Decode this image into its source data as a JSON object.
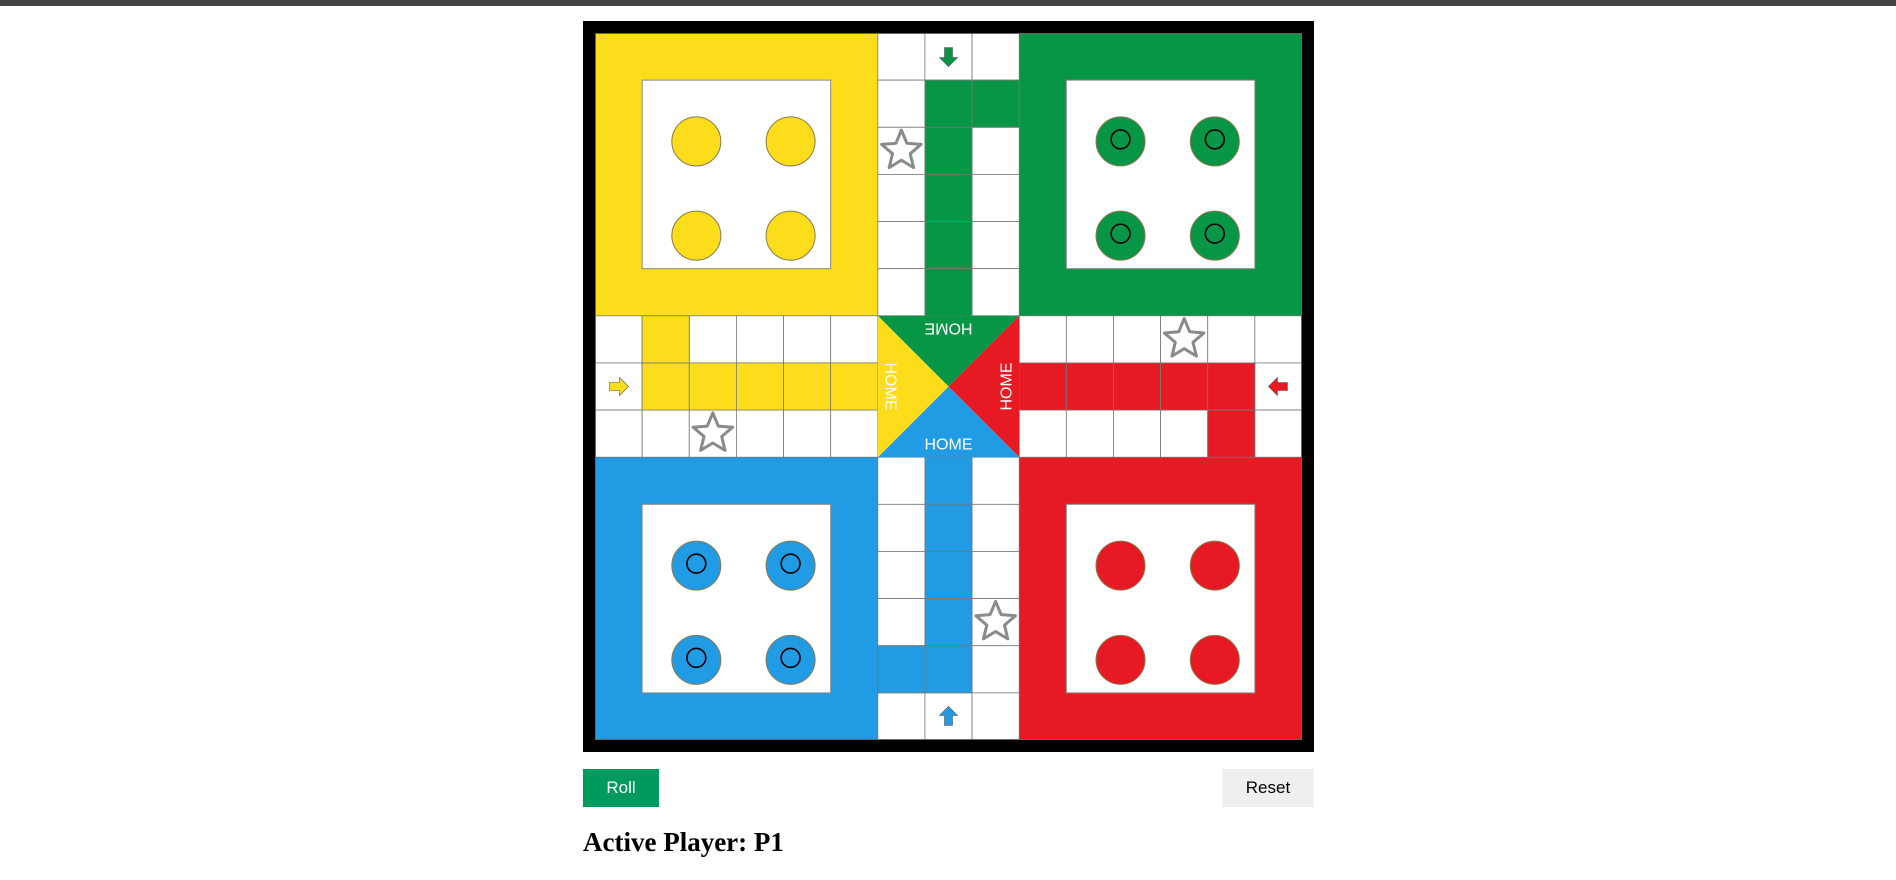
{
  "colors": {
    "yellow": "#FCDD1B",
    "green": "#079645",
    "red": "#E71A23",
    "blue": "#229BE5",
    "roll_button": "#009A5C",
    "reset_button": "#EFEFEF",
    "top_bar": "#444444"
  },
  "board": {
    "center_labels": [
      "HOME",
      "HOME",
      "HOME",
      "HOME"
    ],
    "icons": [
      "start-arrow-icon",
      "safe-star-icon",
      "token-icon"
    ],
    "tokens": {
      "yellow": {
        "count": 4,
        "marked": false
      },
      "green": {
        "count": 4,
        "marked": true
      },
      "red": {
        "count": 4,
        "marked": false
      },
      "blue": {
        "count": 4,
        "marked": true
      }
    }
  },
  "controls": {
    "roll_label": "Roll",
    "reset_label": "Reset"
  },
  "status": {
    "active_player_text": "Active Player: P1"
  }
}
